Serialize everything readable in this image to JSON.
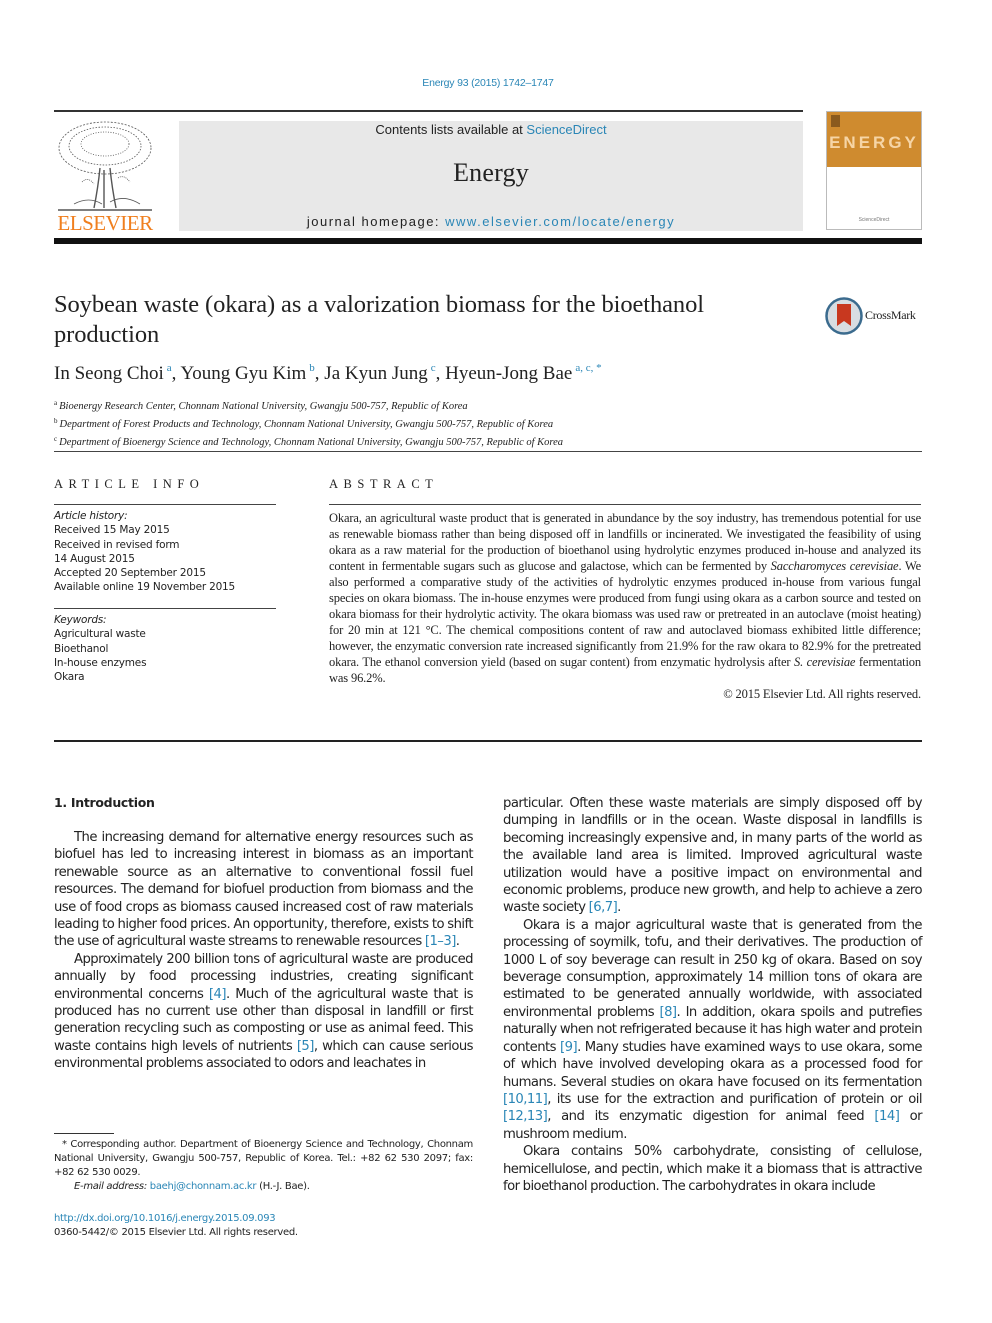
{
  "header": {
    "citation": "Energy 93 (2015) 1742–1747",
    "contents_prefix": "Contents lists available at ",
    "contents_link": "ScienceDirect",
    "journal_name": "Energy",
    "homepage_prefix": "journal homepage: ",
    "homepage_link": "www.elsevier.com/locate/energy",
    "publisher_logo_text": "ELSEVIER",
    "cover_title": "ENERGY",
    "cover_footer": "ScienceDirect",
    "colors": {
      "link": "#2a86b6",
      "elsevier_orange": "#f07f1e",
      "cover_orange": "#cf8b2f"
    }
  },
  "article": {
    "title": "Soybean waste (okara) as a valorization biomass for the bioethanol production",
    "crossmark_label": "CrossMark",
    "authors": [
      {
        "name": "In Seong Choi",
        "sup": "a"
      },
      {
        "name": "Young Gyu Kim",
        "sup": "b"
      },
      {
        "name": "Ja Kyun Jung",
        "sup": "c"
      },
      {
        "name": "Hyeun-Jong Bae",
        "sup": "a, c, *"
      }
    ],
    "affiliations": [
      {
        "sup": "a",
        "text": "Bioenergy Research Center, Chonnam National University, Gwangju 500-757, Republic of Korea"
      },
      {
        "sup": "b",
        "text": "Department of Forest Products and Technology, Chonnam National University, Gwangju 500-757, Republic of Korea"
      },
      {
        "sup": "c",
        "text": "Department of Bioenergy Science and Technology, Chonnam National University, Gwangju 500-757, Republic of Korea"
      }
    ]
  },
  "article_info": {
    "heading": "ARTICLE INFO",
    "history_label": "Article history:",
    "history": [
      "Received 15 May 2015",
      "Received in revised form",
      "14 August 2015",
      "Accepted 20 September 2015",
      "Available online 19 November 2015"
    ],
    "keywords_label": "Keywords:",
    "keywords": [
      "Agricultural waste",
      "Bioethanol",
      "In-house enzymes",
      "Okara"
    ]
  },
  "abstract": {
    "heading": "ABSTRACT",
    "part1": "Okara, an agricultural waste product that is generated in abundance by the soy industry, has tremendous potential for use as renewable biomass rather than being disposed off in landfills or incinerated. We investigated the feasibility of using okara as a raw material for the production of bioethanol using hydrolytic enzymes produced in-house and analyzed its content in fermentable sugars such as glucose and galactose, which can be fermented by ",
    "species1": "Saccharomyces cerevisiae",
    "part2": ". We also performed a comparative study of the activities of hydrolytic enzymes produced in-house from various fungal species on okara biomass. The in-house enzymes were produced from fungi using okara as a carbon source and tested on okara biomass for their hydrolytic activity. The okara biomass was used raw or pretreated in an autoclave (moist heating) for 20 min at 121 °C. The chemical compositions content of raw and autoclaved biomass exhibited little difference; however, the enzymatic conversion rate increased significantly from 21.9% for the raw okara to 82.9% for the pretreated okara. The ethanol conversion yield (based on sugar content) from enzymatic hydrolysis after ",
    "species2": "S. cerevisiae",
    "part3": " fermentation was 96.2%.",
    "copyright": "© 2015 Elsevier Ltd. All rights reserved."
  },
  "introduction": {
    "heading": "1.  Introduction",
    "p1_text": "The increasing demand for alternative energy resources such as biofuel has led to increasing interest in biomass as an important renewable source as an alternative to conventional fossil fuel resources. The demand for biofuel production from biomass and the use of food crops as biomass caused increased cost of raw materials leading to higher food prices. An opportunity, therefore, exists to shift the use of agricultural waste streams to renewable resources ",
    "p1_ref": "[1–3]",
    "p1_end": ".",
    "p2_a": "Approximately 200 billion tons of agricultural waste are produced annually by food processing industries, creating significant environmental concerns ",
    "p2_ref1": "[4]",
    "p2_b": ". Much of the agricultural waste that is produced has no current use other than disposal in landfill or first generation recycling such as composting or use as animal feed. This waste contains high levels of nutrients ",
    "p2_ref2": "[5]",
    "p2_c": ", which can cause serious environmental problems associated to odors and leachates in",
    "col2_p2_cont_a": "particular. Often these waste materials are simply disposed off by dumping in landfills or in the ocean. Waste disposal in landfills is becoming increasingly expensive and, in many parts of the world as the available land area is limited. Improved agricultural waste utilization would have a positive impact on environmental and economic problems, produce new growth, and help to achieve a zero waste society ",
    "col2_ref67": "[6,7]",
    "col2_p2_end": ".",
    "p3_a": "Okara is a major agricultural waste that is generated from the processing of soymilk, tofu, and their derivatives. The production of 1000 L of soy beverage can result in 250 kg of okara. Based on soy beverage consumption, approximately 14 million tons of okara are estimated to be generated annually worldwide, with associated environmental problems ",
    "p3_ref8": "[8]",
    "p3_b": ". In addition, okara spoils and putrefies naturally when not refrigerated because it has high water and protein contents ",
    "p3_ref9": "[9]",
    "p3_c": ". Many studies have examined ways to use okara, some of which have involved developing okara as a processed food for humans. Several studies on okara have focused on its fermentation ",
    "p3_ref1011": "[10,11]",
    "p3_d": ", its use for the extraction and purification of protein or oil ",
    "p3_ref1213": "[12,13]",
    "p3_e": ", and its enzymatic digestion for animal feed ",
    "p3_ref14": "[14]",
    "p3_f": " or mushroom medium.",
    "p4": "Okara contains 50% carbohydrate, consisting of cellulose, hemicellulose, and pectin, which make it a biomass that is attractive for bioethanol production. The carbohydrates in okara include"
  },
  "footnote": {
    "corresponding": "* Corresponding author. Department of Bioenergy Science and Technology, Chonnam National University, Gwangju 500-757, Republic of Korea. Tel.: +82 62 530 2097; fax: +82 62 530 0029.",
    "email_label": "E-mail address: ",
    "email": "baehj@chonnam.ac.kr",
    "email_suffix": " (H.-J. Bae).",
    "doi": "http://dx.doi.org/10.1016/j.energy.2015.09.093",
    "issn": "0360-5442/© 2015 Elsevier Ltd. All rights reserved."
  }
}
